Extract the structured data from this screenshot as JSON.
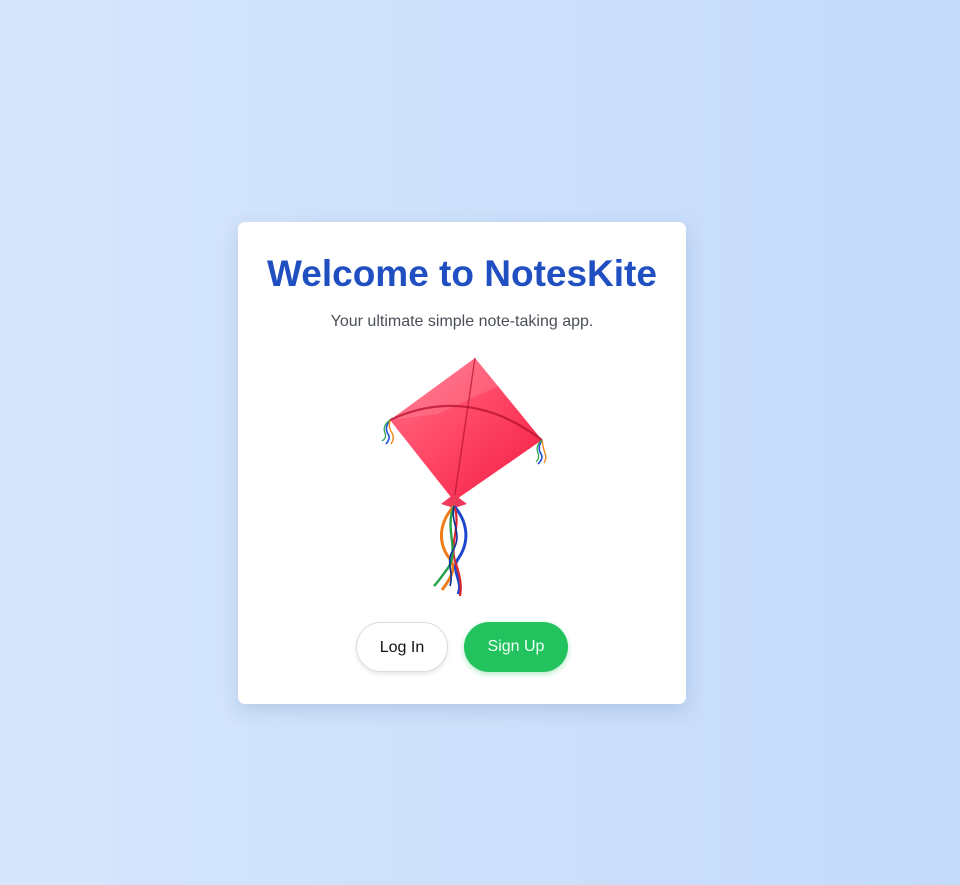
{
  "welcome": {
    "title": "Welcome to NotesKite",
    "subtitle": "Your ultimate simple note-taking app."
  },
  "illustration": {
    "icon": "kite-icon"
  },
  "actions": {
    "login_label": "Log In",
    "signup_label": "Sign Up"
  },
  "colors": {
    "title": "#1f4fc1",
    "kite": "#ff3d5c",
    "signup_button": "#22c35e",
    "background": "#cde0fb"
  }
}
